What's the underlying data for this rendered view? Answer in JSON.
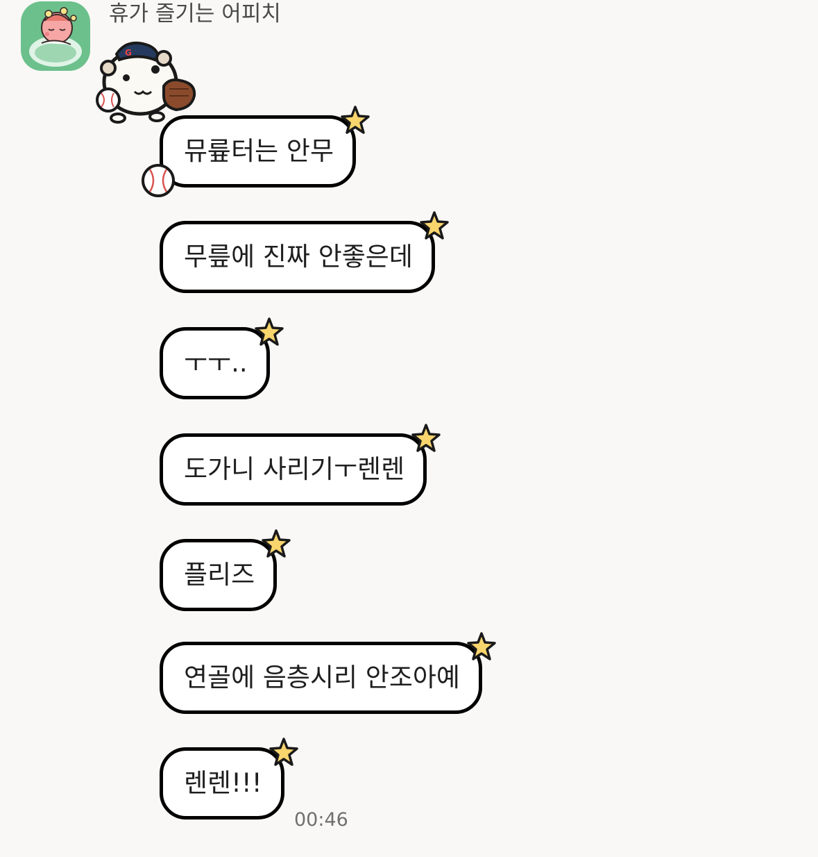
{
  "sender": {
    "name": "휴가 즐기는 어피치",
    "avatar_icon": "apeach-profile-icon"
  },
  "sticker_icon": "baseball-hamster-icon",
  "messages": [
    {
      "text": "뮤륲터는 안무"
    },
    {
      "text": "무릎에 진짜 안좋은데"
    },
    {
      "text": "ㅜㅜ.."
    },
    {
      "text": "도가니 사리기ㅜ렌렌"
    },
    {
      "text": "플리즈"
    },
    {
      "text": "연골에 음층시리 안조아예"
    },
    {
      "text": "렌렌!!!"
    }
  ],
  "timestamp": "00:46",
  "colors": {
    "background": "#f9f8f6",
    "bubble_border": "#000000",
    "star_fill": "#f9d56e",
    "avatar_bg": "#6cc08c"
  }
}
